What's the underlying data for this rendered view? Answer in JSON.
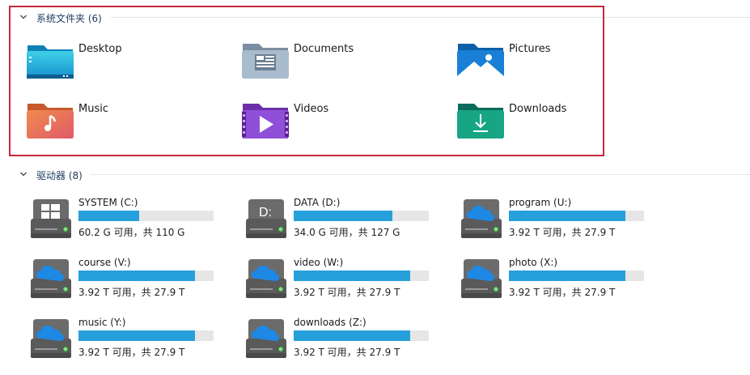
{
  "sections": {
    "folders": {
      "title": "系统文件夹 (6)"
    },
    "drives": {
      "title": "驱动器 (8)"
    }
  },
  "folders": [
    {
      "label": "Desktop",
      "icon": "desktop-folder-icon"
    },
    {
      "label": "Documents",
      "icon": "documents-folder-icon"
    },
    {
      "label": "Pictures",
      "icon": "pictures-folder-icon"
    },
    {
      "label": "Music",
      "icon": "music-folder-icon"
    },
    {
      "label": "Videos",
      "icon": "videos-folder-icon"
    },
    {
      "label": "Downloads",
      "icon": "downloads-folder-icon"
    }
  ],
  "drives": [
    {
      "name": "SYSTEM (C:)",
      "size": "60.2 G 可用，共 110 G",
      "used_fraction": 0.45,
      "icon": "windows-drive-icon"
    },
    {
      "name": "DATA (D:)",
      "size": "34.0 G 可用，共 127 G",
      "used_fraction": 0.73,
      "icon": "d-drive-icon"
    },
    {
      "name": "program (U:)",
      "size": "3.92 T 可用，共 27.9 T",
      "used_fraction": 0.86,
      "icon": "cloud-drive-icon"
    },
    {
      "name": "course (V:)",
      "size": "3.92 T 可用，共 27.9 T",
      "used_fraction": 0.86,
      "icon": "cloud-drive-icon"
    },
    {
      "name": "video (W:)",
      "size": "3.92 T 可用，共 27.9 T",
      "used_fraction": 0.86,
      "icon": "cloud-drive-icon"
    },
    {
      "name": "photo (X:)",
      "size": "3.92 T 可用，共 27.9 T",
      "used_fraction": 0.86,
      "icon": "cloud-drive-icon"
    },
    {
      "name": "music (Y:)",
      "size": "3.92 T 可用，共 27.9 T",
      "used_fraction": 0.86,
      "icon": "cloud-drive-icon"
    },
    {
      "name": "downloads (Z:)",
      "size": "3.92 T 可用，共 27.9 T",
      "used_fraction": 0.86,
      "icon": "cloud-drive-icon"
    }
  ],
  "colors": {
    "bar_fill": "#26a0da",
    "bar_track": "#e6e6e6",
    "highlight": "#c42b3b"
  }
}
